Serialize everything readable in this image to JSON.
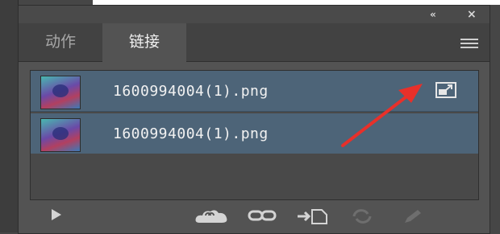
{
  "panel": {
    "collapse_glyph": "«",
    "close_glyph": "×",
    "tabs": [
      {
        "label": "动作",
        "active": false
      },
      {
        "label": "链接",
        "active": true
      }
    ],
    "menu_icon": "hamburger-menu-icon"
  },
  "links": [
    {
      "filename": "1600994004(1).png",
      "selected": true,
      "has_goto_icon": true
    },
    {
      "filename": "1600994004(1).png",
      "selected": true,
      "has_goto_icon": false
    }
  ],
  "footer_icons": [
    "play-icon",
    "cloud-icon",
    "relink-icon",
    "embed-icon",
    "update-icon",
    "edit-original-icon"
  ],
  "colors": {
    "panel_bg": "#535353",
    "selected_row": "#4d6478",
    "annotation_arrow": "#e8302a"
  }
}
